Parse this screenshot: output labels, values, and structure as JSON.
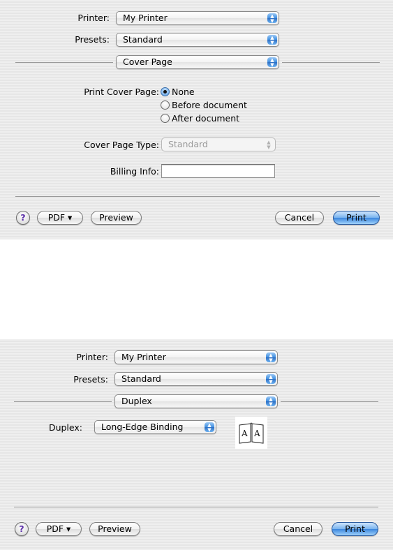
{
  "dialog1": {
    "printer_label": "Printer:",
    "printer_value": "My Printer",
    "presets_label": "Presets:",
    "presets_value": "Standard",
    "pane_value": "Cover Page",
    "print_cover_page_label": "Print Cover Page:",
    "radio_options": [
      "None",
      "Before document",
      "After document"
    ],
    "radio_selected": "None",
    "cover_page_type_label": "Cover Page Type:",
    "cover_page_type_value": "Standard",
    "billing_info_label": "Billing Info:",
    "billing_info_value": "",
    "buttons": {
      "help": "?",
      "pdf": "PDF ▾",
      "preview": "Preview",
      "cancel": "Cancel",
      "print": "Print"
    }
  },
  "dialog2": {
    "printer_label": "Printer:",
    "printer_value": "My Printer",
    "presets_label": "Presets:",
    "presets_value": "Standard",
    "pane_value": "Duplex",
    "duplex_label": "Duplex:",
    "duplex_value": "Long-Edge Binding",
    "duplex_icon": "open-book-icon",
    "duplex_icon_text": "A A",
    "buttons": {
      "help": "?",
      "pdf": "PDF ▾",
      "preview": "Preview",
      "cancel": "Cancel",
      "print": "Print"
    }
  },
  "colors": {
    "accent": "#3b86de",
    "panel_background": "#ececec"
  }
}
